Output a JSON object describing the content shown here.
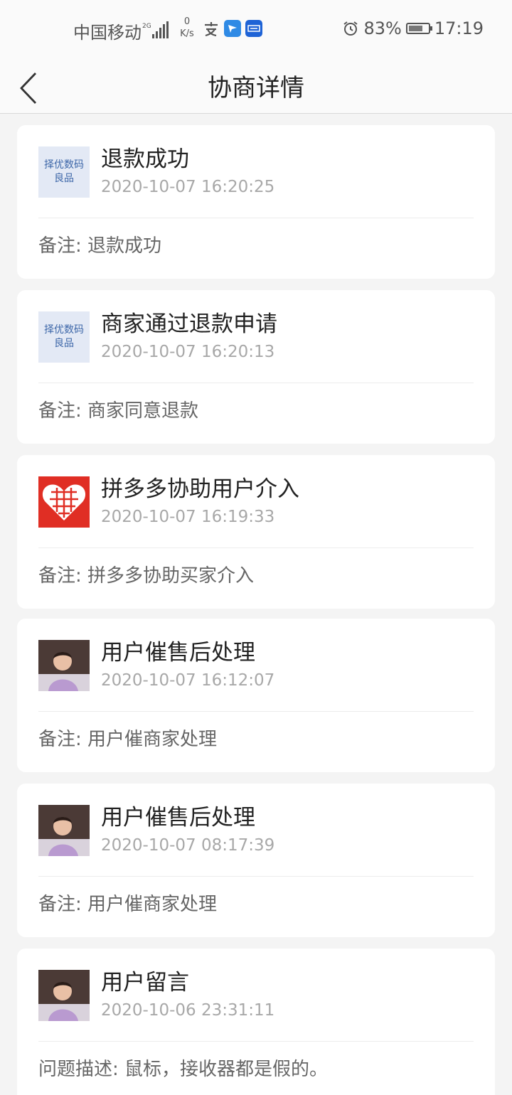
{
  "status_bar": {
    "carrier": "中国移动",
    "network": "2G",
    "speed_value": "0",
    "speed_unit": "K/s",
    "battery": "83%",
    "battery_level": 0.83,
    "time": "17:19"
  },
  "header": {
    "title": "协商详情"
  },
  "records": [
    {
      "avatar": "store-logo",
      "avatar_text": "择优数码良品",
      "title": "退款成功",
      "time": "2020-10-07  16:20:25",
      "note": "备注: 退款成功"
    },
    {
      "avatar": "store-logo",
      "avatar_text": "择优数码良品",
      "title": "商家通过退款申请",
      "time": "2020-10-07  16:20:13",
      "note": "备注: 商家同意退款"
    },
    {
      "avatar": "pinduoduo-logo",
      "avatar_text": "",
      "title": "拼多多协助用户介入",
      "time": "2020-10-07  16:19:33",
      "note": "备注: 拼多多协助买家介入"
    },
    {
      "avatar": "user-photo",
      "avatar_text": "",
      "title": "用户催售后处理",
      "time": "2020-10-07  16:12:07",
      "note": "备注: 用户催商家处理"
    },
    {
      "avatar": "user-photo",
      "avatar_text": "",
      "title": "用户催售后处理",
      "time": "2020-10-07  08:17:39",
      "note": "备注: 用户催商家处理"
    },
    {
      "avatar": "user-photo",
      "avatar_text": "",
      "title": "用户留言",
      "time": "2020-10-06  23:31:11",
      "note": "问题描述: 鼠标，接收器都是假的。"
    }
  ]
}
